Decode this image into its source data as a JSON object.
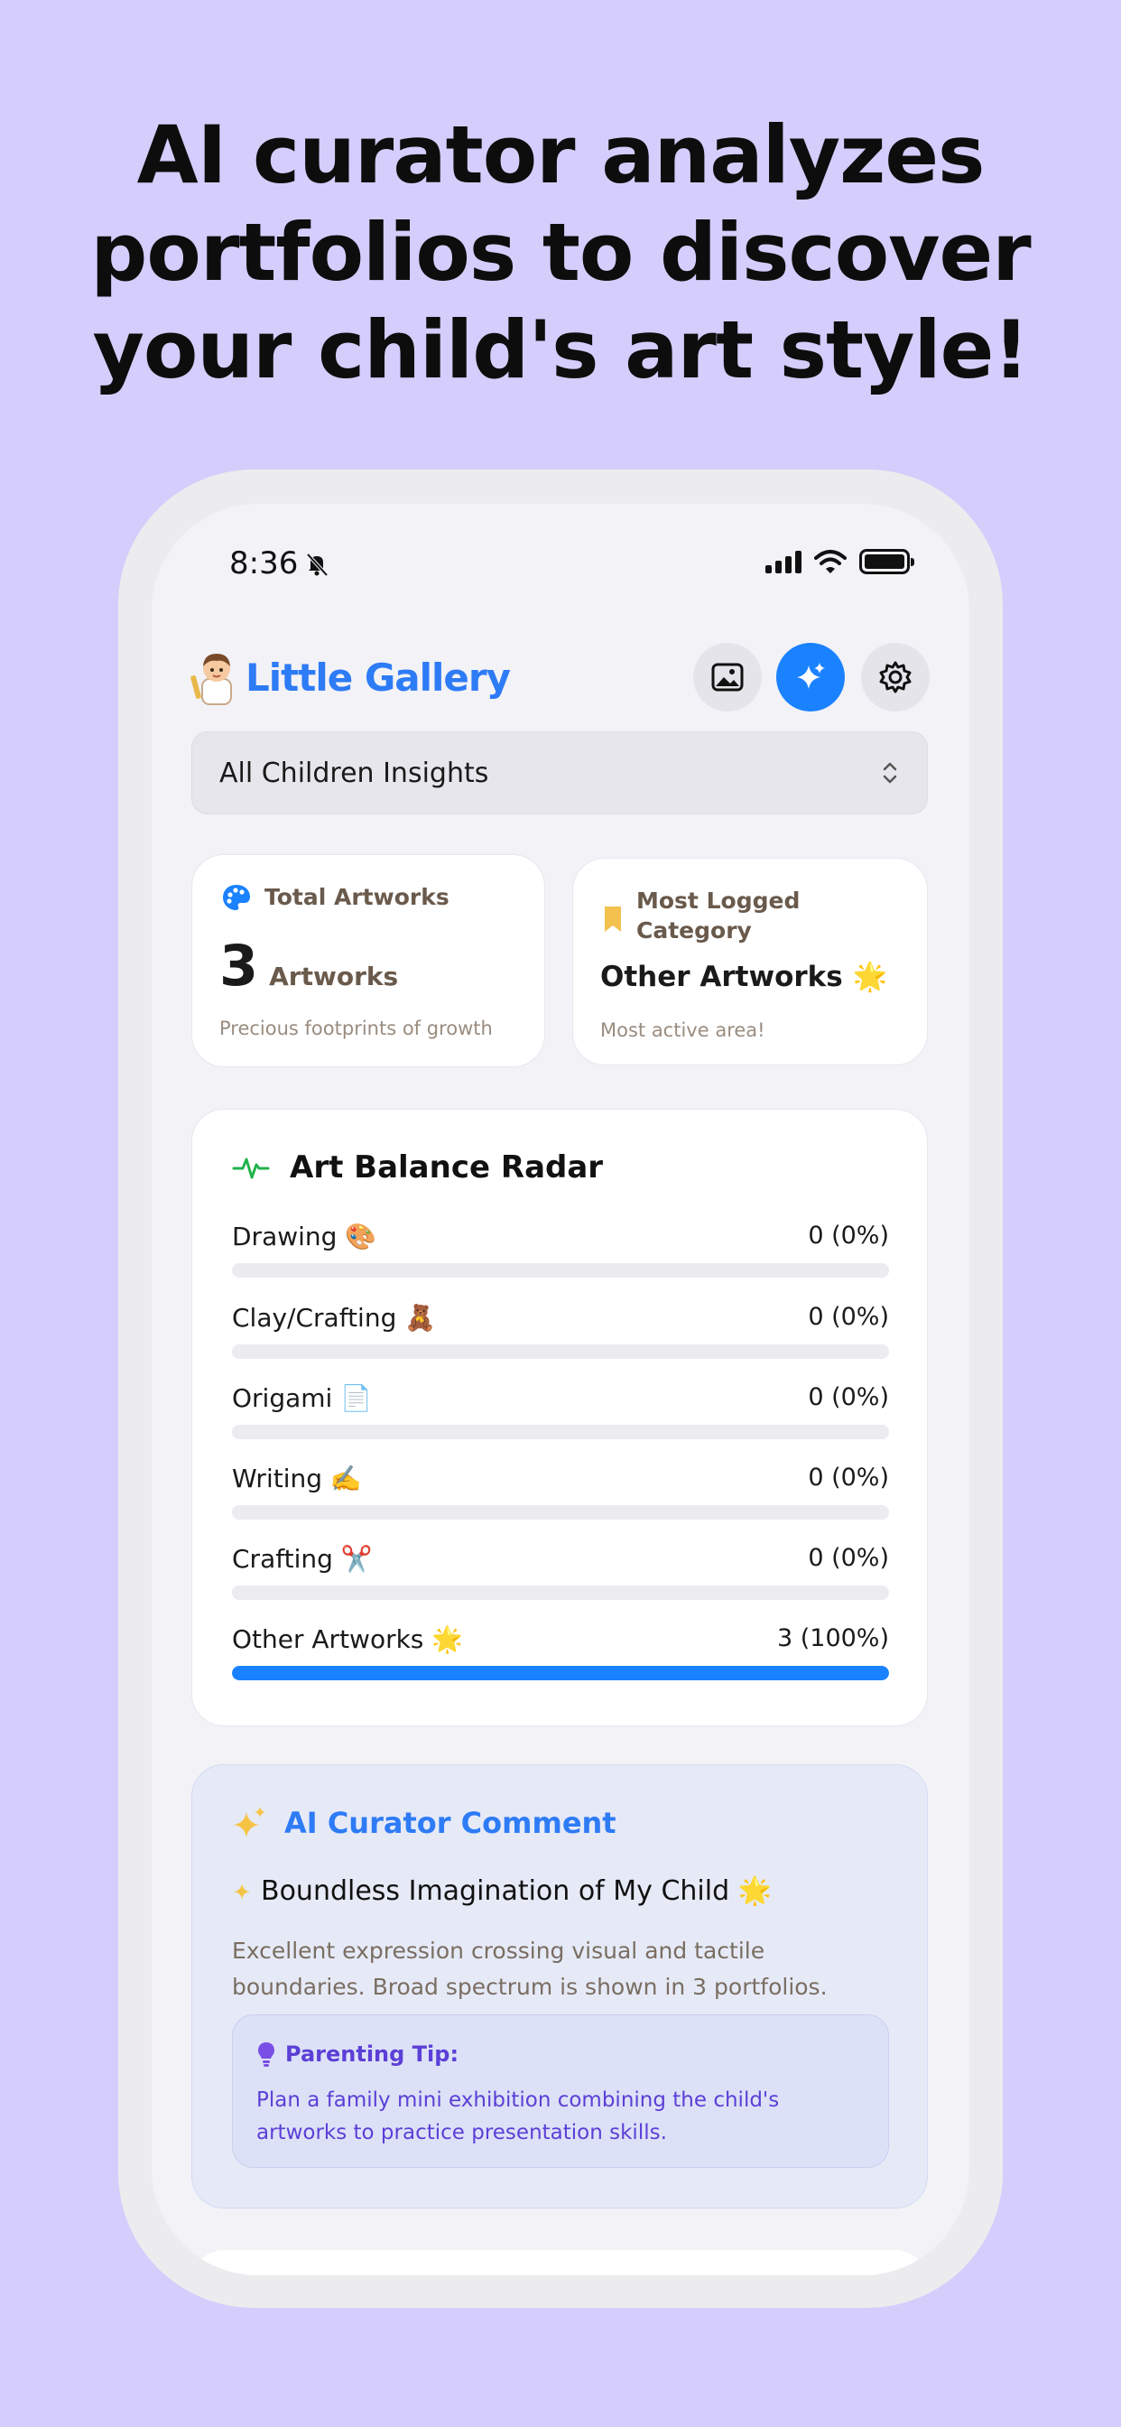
{
  "headline": {
    "line1": "AI curator analyzes",
    "line2": "portfolios to discover",
    "line3": "your child's art style!"
  },
  "status_bar": {
    "time": "8:36",
    "icons": [
      "bell-slash-icon",
      "signal-icon",
      "wifi-icon",
      "battery-icon"
    ]
  },
  "app": {
    "title": "Little Gallery",
    "header_buttons": [
      "image-icon",
      "sparkle-icon",
      "gear-icon"
    ]
  },
  "selector": {
    "label": "All Children Insights"
  },
  "stats": {
    "total": {
      "title": "Total Artworks",
      "count": "3",
      "unit": "Artworks",
      "subtitle": "Precious footprints of growth"
    },
    "most_logged": {
      "title_line1": "Most Logged",
      "title_line2": "Category",
      "category": "Other Artworks 🌟",
      "subtitle": "Most active area!"
    }
  },
  "radar": {
    "title": "Art Balance Radar",
    "rows": [
      {
        "label": "Drawing 🎨",
        "value": "0 (0%)",
        "fraction": 0
      },
      {
        "label": "Clay/Crafting 🧸",
        "value": "0 (0%)",
        "fraction": 0
      },
      {
        "label": "Origami 📄",
        "value": "0 (0%)",
        "fraction": 0
      },
      {
        "label": "Writing ✍️",
        "value": "0 (0%)",
        "fraction": 0
      },
      {
        "label": "Crafting ✂️",
        "value": "0 (0%)",
        "fraction": 0
      },
      {
        "label": "Other Artworks 🌟",
        "value": "3 (100%)",
        "fraction": 1
      }
    ]
  },
  "ai_comment": {
    "title": "AI Curator Comment",
    "headline": "Boundless Imagination of My Child 🌟",
    "body_line1": "Excellent expression crossing visual and tactile",
    "body_line2": "boundaries. Broad spectrum is shown in 3 portfolios.",
    "tip_title": "Parenting Tip:",
    "tip_line1": "Plan a family mini exhibition combining the child's",
    "tip_line2": "artworks to practice presentation skills."
  },
  "colors": {
    "background": "#d5cdfb",
    "accent": "#1a82ff",
    "title_blue": "#2e7bf6",
    "tip_purple": "#5b3fd6"
  }
}
